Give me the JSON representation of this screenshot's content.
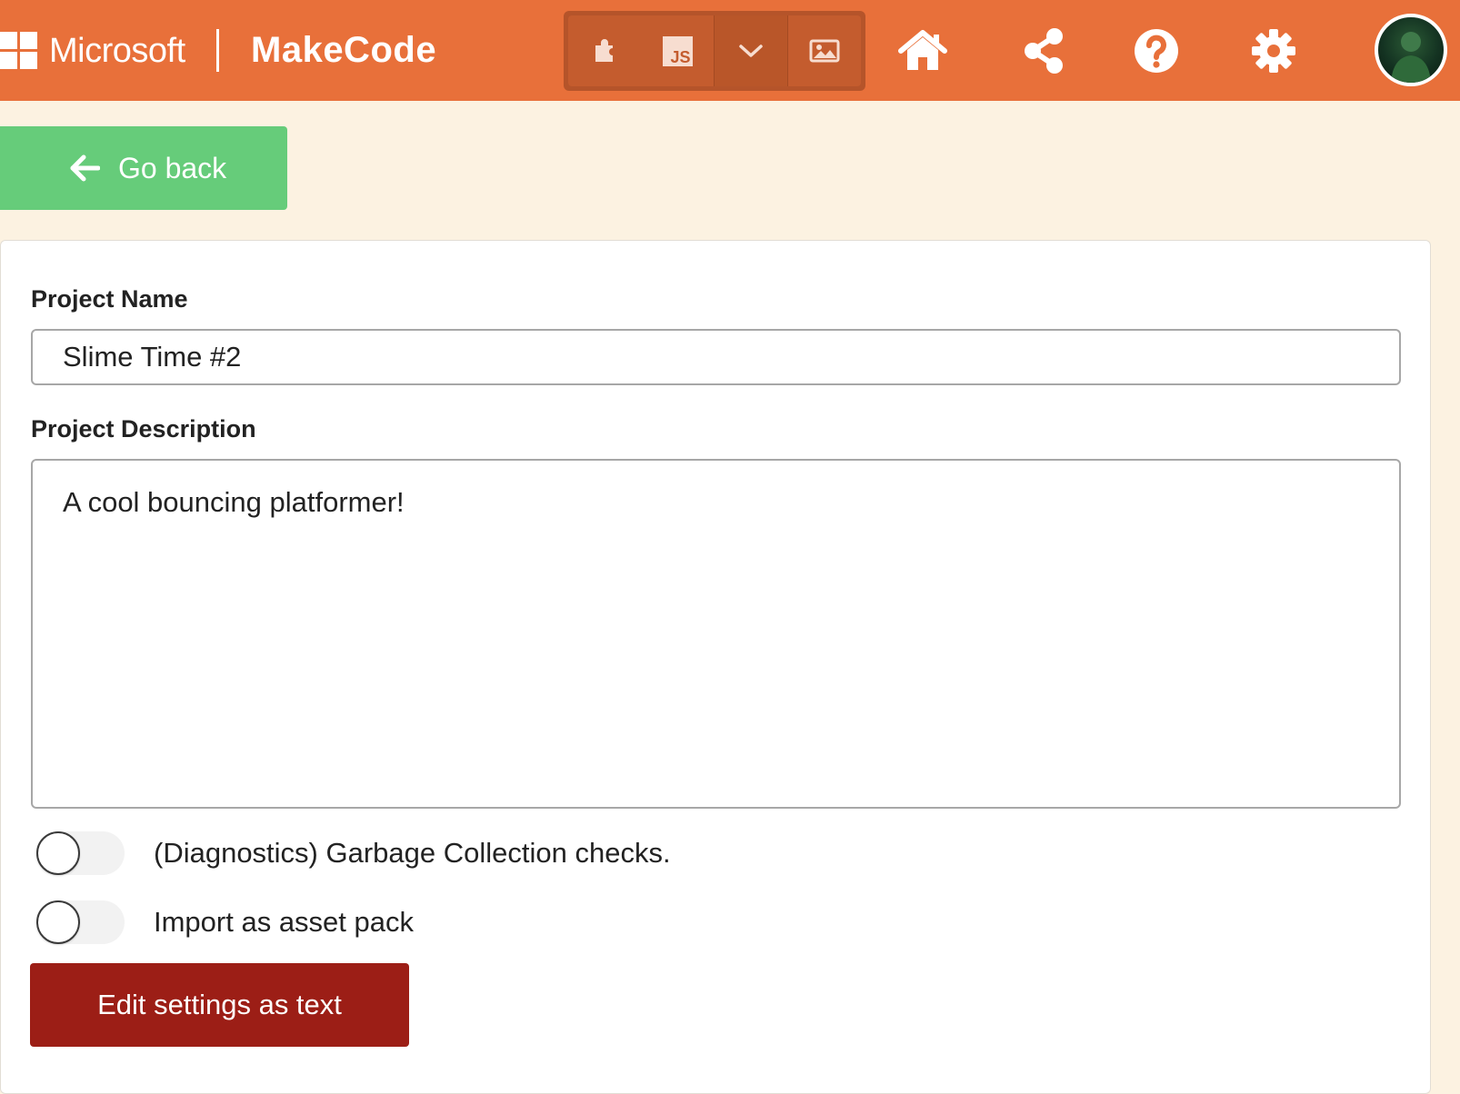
{
  "header": {
    "brand_company": "Microsoft",
    "brand_product": "MakeCode",
    "editor_toggle": {
      "blocks_icon": "puzzle-piece-icon",
      "js_label": "JS",
      "dropdown_icon": "chevron-down-icon",
      "assets_icon": "image-icon"
    },
    "actions": [
      {
        "name": "home-button",
        "icon": "home-icon"
      },
      {
        "name": "share-button",
        "icon": "share-icon"
      },
      {
        "name": "help-button",
        "icon": "question-circle-icon"
      },
      {
        "name": "settings-button",
        "icon": "gear-icon"
      }
    ],
    "accent_color": "#e8703a"
  },
  "nav": {
    "go_back_label": "Go back",
    "go_back_color": "#66cc7a"
  },
  "settings": {
    "project_name_label": "Project Name",
    "project_name_value": "Slime Time #2",
    "project_description_label": "Project Description",
    "project_description_value": "A cool bouncing platformer!",
    "toggles": [
      {
        "label": "(Diagnostics) Garbage Collection checks.",
        "on": false
      },
      {
        "label": "Import as asset pack",
        "on": false
      }
    ],
    "edit_as_text_label": "Edit settings as text",
    "edit_as_text_color": "#9c1e16"
  }
}
